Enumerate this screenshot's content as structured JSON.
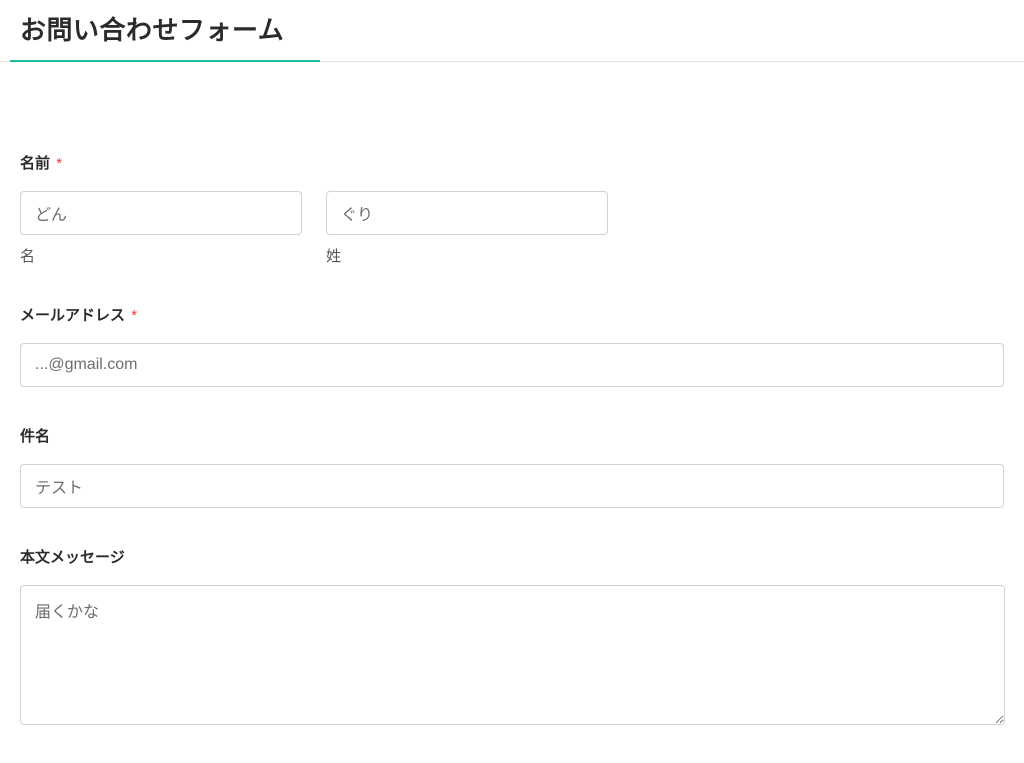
{
  "page_title": "お問い合わせフォーム",
  "required_mark": "*",
  "fields": {
    "name": {
      "label": "名前",
      "first": {
        "value": "どん",
        "sublabel": "名"
      },
      "last": {
        "value": "ぐり",
        "sublabel": "姓"
      }
    },
    "email": {
      "label": "メールアドレス",
      "value": "...@gmail.com"
    },
    "subject": {
      "label": "件名",
      "value": "テスト"
    },
    "message": {
      "label": "本文メッセージ",
      "value": "届くかな"
    }
  }
}
